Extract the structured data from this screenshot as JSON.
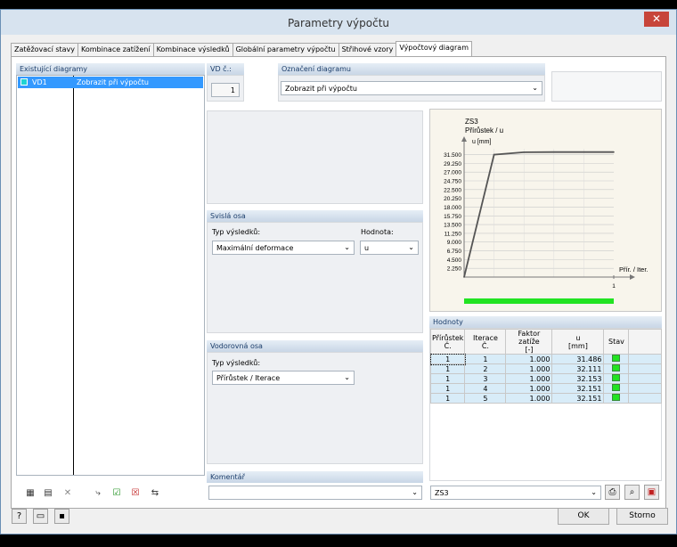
{
  "window": {
    "title": "Parametry výpočtu"
  },
  "tabs": [
    "Zatěžovací stavy",
    "Kombinace zatížení",
    "Kombinace výsledků",
    "Globální parametry výpočtu",
    "Střihové vzory",
    "Výpočtový diagram"
  ],
  "left": {
    "title": "Existující diagramy",
    "items": [
      {
        "id": "VD1",
        "name": "Zobrazit při výpočtu",
        "color": "#1fd3d3"
      }
    ]
  },
  "vd": {
    "label": "VD č.:",
    "value": "1"
  },
  "oznaceni": {
    "label": "Označení diagramu",
    "value": "Zobrazit při výpočtu"
  },
  "svisla": {
    "title": "Svislá osa",
    "typ_label": "Typ výsledků:",
    "typ_value": "Maximální deformace",
    "hodnota_label": "Hodnota:",
    "hodnota_value": "u"
  },
  "vodorovna": {
    "title": "Vodorovná osa",
    "typ_label": "Typ výsledků:",
    "typ_value": "Přírůstek / Iterace"
  },
  "komentar": {
    "title": "Komentář",
    "value": ""
  },
  "chart_data": {
    "type": "line",
    "title": "ZS3",
    "subtitle": "Přírůstek / u",
    "ylabel": "u [mm]",
    "xlabel": "Přír. / Iter.",
    "yticks": [
      "31.500",
      "29.250",
      "27.000",
      "24.750",
      "22.500",
      "20.250",
      "18.000",
      "15.750",
      "13.500",
      "11.250",
      "9.000",
      "6.750",
      "4.500",
      "2.250"
    ],
    "ytick_values": [
      31.5,
      29.25,
      27.0,
      24.75,
      22.5,
      20.25,
      18.0,
      15.75,
      13.5,
      11.25,
      9.0,
      6.75,
      4.5,
      2.25
    ],
    "xtick": "1",
    "ylim": [
      0,
      33
    ],
    "series": [
      {
        "x": [
          0,
          1,
          2,
          3,
          4,
          5
        ],
        "values": [
          0,
          31.486,
          32.111,
          32.153,
          32.151,
          32.151
        ]
      }
    ],
    "line_color": "#555555",
    "progress_color": "#22e322"
  },
  "hodnoty": {
    "title": "Hodnoty",
    "headers": [
      [
        "Přírůstek",
        "Č."
      ],
      [
        "Iterace",
        "Č."
      ],
      [
        "Faktor zatíže",
        "[-]"
      ],
      [
        "u",
        "[mm]"
      ],
      [
        "Stav",
        ""
      ]
    ],
    "rows": [
      [
        "1",
        "1",
        "1.000",
        "31.486"
      ],
      [
        "1",
        "2",
        "1.000",
        "32.111"
      ],
      [
        "1",
        "3",
        "1.000",
        "32.153"
      ],
      [
        "1",
        "4",
        "1.000",
        "32.151"
      ],
      [
        "1",
        "5",
        "1.000",
        "32.151"
      ]
    ],
    "stav_color": "#22e322"
  },
  "load_case_select": "ZS3",
  "buttons": {
    "ok": "OK",
    "cancel": "Storno"
  }
}
